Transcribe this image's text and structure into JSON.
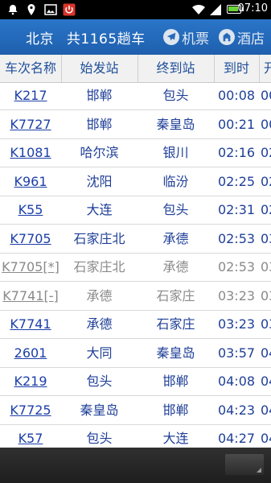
{
  "status_bar": {
    "time": "07:10"
  },
  "title_bar": {
    "station": "北京",
    "count_text": "共1165趟车",
    "flight_label": "机票",
    "hotel_label": "酒店"
  },
  "table": {
    "headers": [
      "车次名称",
      "始发站",
      "终到站",
      "到时",
      "开"
    ],
    "rows": [
      {
        "train": "K217",
        "from": "邯郸",
        "to": "包头",
        "arrive": "00:08",
        "depart": "00",
        "muted": false
      },
      {
        "train": "K7727",
        "from": "邯郸",
        "to": "秦皇岛",
        "arrive": "00:21",
        "depart": "00",
        "muted": false
      },
      {
        "train": "K1081",
        "from": "哈尔滨",
        "to": "银川",
        "arrive": "02:16",
        "depart": "02",
        "muted": false
      },
      {
        "train": "K961",
        "from": "沈阳",
        "to": "临汾",
        "arrive": "02:25",
        "depart": "02",
        "muted": false
      },
      {
        "train": "K55",
        "from": "大连",
        "to": "包头",
        "arrive": "02:31",
        "depart": "02",
        "muted": false
      },
      {
        "train": "K7705",
        "from": "石家庄北",
        "to": "承德",
        "arrive": "02:53",
        "depart": "03",
        "muted": false
      },
      {
        "train": "K7705[*]",
        "from": "石家庄北",
        "to": "承德",
        "arrive": "02:53",
        "depart": "03",
        "muted": true
      },
      {
        "train": "K7741[-]",
        "from": "承德",
        "to": "石家庄",
        "arrive": "03:23",
        "depart": "03",
        "muted": true
      },
      {
        "train": "K7741",
        "from": "承德",
        "to": "石家庄",
        "arrive": "03:23",
        "depart": "03",
        "muted": false
      },
      {
        "train": "2601",
        "from": "大同",
        "to": "秦皇岛",
        "arrive": "03:57",
        "depart": "04",
        "muted": false
      },
      {
        "train": "K219",
        "from": "包头",
        "to": "邯郸",
        "arrive": "04:08",
        "depart": "04",
        "muted": false
      },
      {
        "train": "K7725",
        "from": "秦皇岛",
        "to": "邯郸",
        "arrive": "04:23",
        "depart": "04",
        "muted": false
      },
      {
        "train": "K57",
        "from": "包头",
        "to": "大连",
        "arrive": "04:27",
        "depart": "04",
        "muted": false
      }
    ]
  },
  "colors": {
    "title_bar": "#2668bb",
    "header_text": "#1f4f9a",
    "link": "#1c3fa8",
    "muted": "#8a8a8a"
  },
  "icons": {
    "status_left": [
      "notification-icon",
      "location-icon",
      "image-icon",
      "power-icon"
    ],
    "status_right": [
      "wifi-icon",
      "signal-icon",
      "battery-icon"
    ],
    "title_buttons": [
      "airplane-icon",
      "hotel-icon"
    ],
    "bottom": [
      "overflow-menu-icon"
    ]
  }
}
